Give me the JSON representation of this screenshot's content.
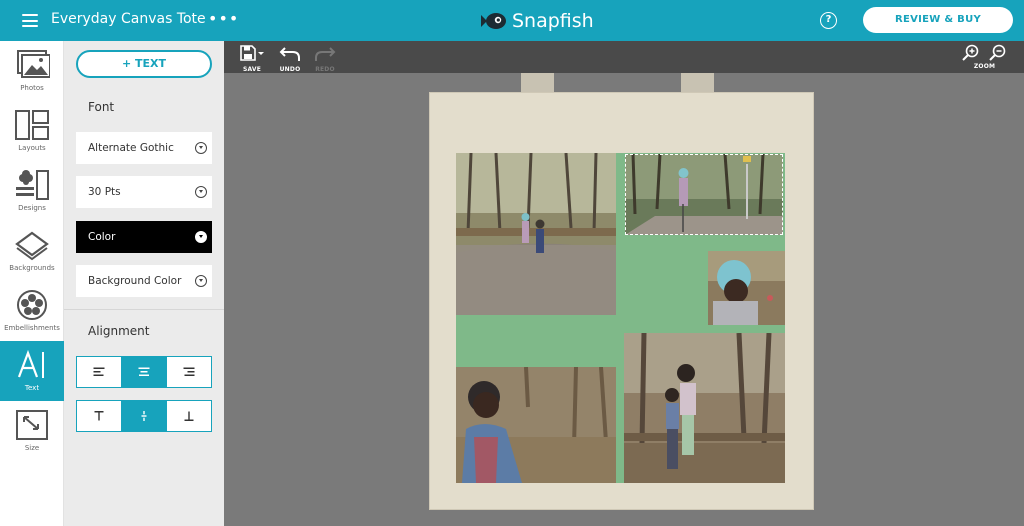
{
  "header": {
    "project_title": "Everyday Canvas Tote",
    "more_icon": "more-dots-icon",
    "brand": "Snapfish",
    "help_label": "?",
    "review_label": "REVIEW & BUY"
  },
  "rail": {
    "items": [
      {
        "label": "Photos",
        "icon": "photos-icon"
      },
      {
        "label": "Layouts",
        "icon": "layouts-icon"
      },
      {
        "label": "Designs",
        "icon": "designs-icon"
      },
      {
        "label": "Backgrounds",
        "icon": "backgrounds-icon"
      },
      {
        "label": "Embellishments",
        "icon": "embellishments-icon"
      },
      {
        "label": "Text",
        "icon": "text-icon",
        "active": true
      },
      {
        "label": "Size",
        "icon": "size-icon"
      }
    ]
  },
  "panel": {
    "add_text": "+ TEXT",
    "font_heading": "Font",
    "font_family": "Alternate Gothic",
    "font_size": "30 Pts",
    "color_label": "Color",
    "bg_color_label": "Background Color",
    "alignment_heading": "Alignment",
    "horizontal_align_selected": "center",
    "vertical_align_selected": "middle"
  },
  "toolbar": {
    "save": "SAVE",
    "undo": "UNDO",
    "redo": "REDO",
    "zoom": "ZOOM"
  },
  "colors": {
    "brand": "#17a3bc",
    "panel_bg": "#ebebeb",
    "canvas_bg": "#7a7a7a",
    "toolbar_bg": "#4a4a4a",
    "design_bg": "#7fb989",
    "tote": "#e3ddcc"
  }
}
